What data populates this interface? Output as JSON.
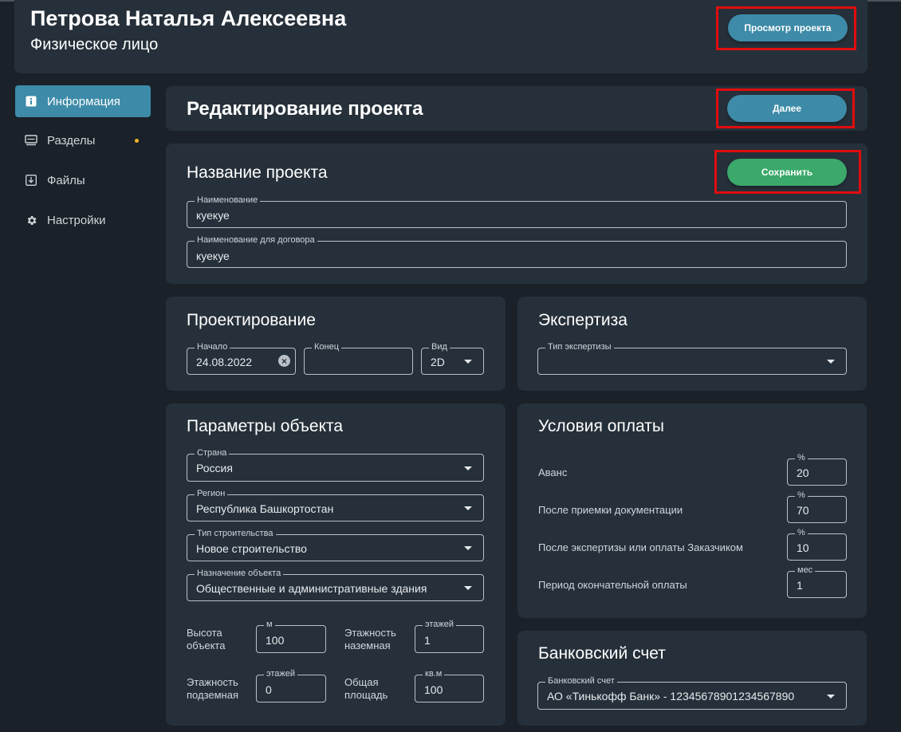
{
  "header": {
    "person_name": "Петрова Наталья Алексеевна",
    "person_type": "Физическое лицо",
    "view_project_label": "Просмотр проекта"
  },
  "sidebar": {
    "items": [
      {
        "label": "Информация",
        "icon": "info-icon",
        "active": true
      },
      {
        "label": "Разделы",
        "icon": "sections-icon",
        "badge": true
      },
      {
        "label": "Файлы",
        "icon": "download-file-icon"
      },
      {
        "label": "Настройки",
        "icon": "gear-icon"
      }
    ]
  },
  "edit": {
    "title": "Редактирование проекта",
    "next_label": "Далее"
  },
  "project_name": {
    "title": "Название проекта",
    "save_label": "Сохранить",
    "name_label": "Наименование",
    "name_value": "куекуе",
    "contract_label": "Наименование для договора",
    "contract_value": "куекуе"
  },
  "design": {
    "title": "Проектирование",
    "start_label": "Начало",
    "start_value": "24.08.2022",
    "end_label": "Конец",
    "end_value": "",
    "kind_label": "Вид",
    "kind_value": "2D"
  },
  "expertise": {
    "title": "Экспертиза",
    "type_label": "Тип экспертизы",
    "type_value": ""
  },
  "object_params": {
    "title": "Параметры объекта",
    "country_label": "Страна",
    "country_value": "Россия",
    "region_label": "Регион",
    "region_value": "Республика Башкортостан",
    "construction_label": "Тип строительства",
    "construction_value": "Новое строительство",
    "purpose_label": "Назначение объекта",
    "purpose_value": "Общественные и административные здания",
    "height_label": "Высота объекта",
    "height_unit": "м",
    "height_value": "100",
    "floors_above_label": "Этажность наземная",
    "floors_above_unit": "этажей",
    "floors_above_value": "1",
    "floors_below_label": "Этажность подземная",
    "floors_below_unit": "этажей",
    "floors_below_value": "0",
    "area_label": "Общая площадь",
    "area_unit": "кв.м",
    "area_value": "100"
  },
  "payment": {
    "title": "Условия оплаты",
    "rows": [
      {
        "label": "Аванс",
        "unit": "%",
        "value": "20"
      },
      {
        "label": "После приемки документации",
        "unit": "%",
        "value": "70"
      },
      {
        "label": "После экспертизы или оплаты Заказчиком",
        "unit": "%",
        "value": "10"
      },
      {
        "label": "Период окончательной оплаты",
        "unit": "мес",
        "value": "1"
      }
    ]
  },
  "bank": {
    "title": "Банковский счет",
    "account_label": "Банковский счет",
    "account_value": "АО «Тинькофф Банк» - 12345678901234567890"
  },
  "colors": {
    "accent_blue": "#3d8ba8",
    "save_green": "#3aa96a",
    "highlight_red": "#e00d0d",
    "badge_orange": "#f0b429"
  }
}
